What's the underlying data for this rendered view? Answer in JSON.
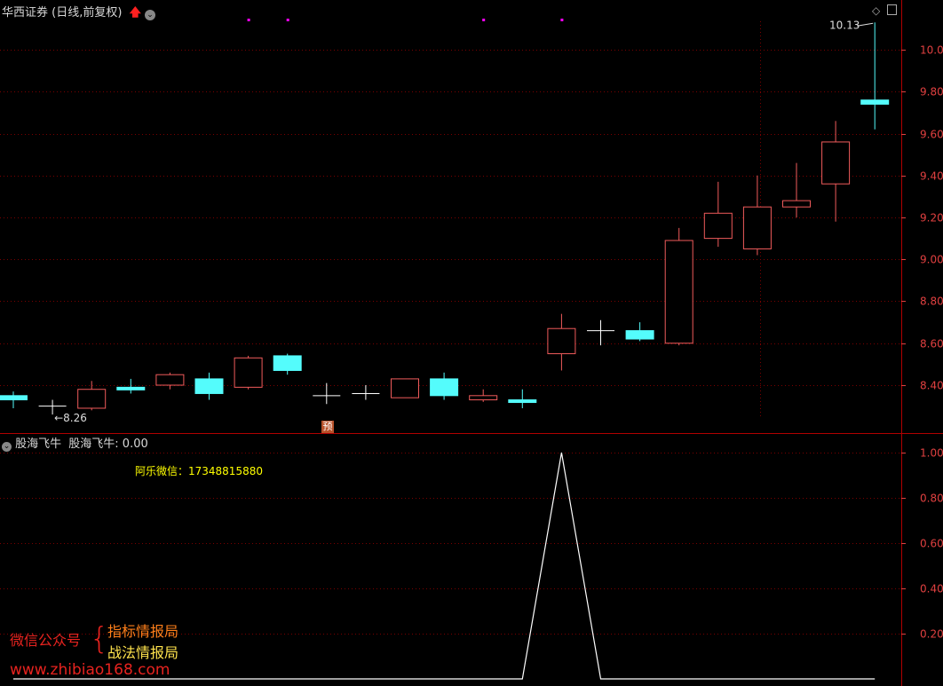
{
  "header": {
    "title": "华西证券 (日线,前复权)",
    "sub_indicator_name": "股海飞牛",
    "sub_indicator_label": "股海飞牛: 0.00",
    "contact": "阿乐微信：17348815880",
    "pre_badge": "预"
  },
  "watermark": {
    "left_text": "微信公众号",
    "line1": "指标情报局",
    "line2": "战法情报局",
    "url": "www.zhibiao168.com"
  },
  "colors": {
    "up": "#f05b5b",
    "down": "#54fcfc",
    "doji": "#ffffff",
    "grid": "#7a0000",
    "axis_text": "#e04040",
    "signal_line": "#ffffff",
    "marker": "#ff00ff",
    "contact_text": "#ffff00",
    "wm_red": "#e8231f",
    "wm_orange": "#ff7f1a",
    "wm_yellow": "#ffe34d"
  },
  "chart_data": [
    {
      "type": "candlestick",
      "title": "华西证券 (日线,前复权)",
      "ylim": [
        8.2,
        10.2
      ],
      "y_ticks": [
        "8.40",
        "8.60",
        "8.80",
        "9.00",
        "9.20",
        "9.40",
        "9.60",
        "9.80",
        "10.00"
      ],
      "high_label": "10.13",
      "low_label": "8.26",
      "candles": [
        {
          "o": 8.35,
          "h": 8.37,
          "l": 8.29,
          "c": 8.33
        },
        {
          "o": 8.3,
          "h": 8.33,
          "l": 8.26,
          "c": 8.3
        },
        {
          "o": 8.29,
          "h": 8.42,
          "l": 8.28,
          "c": 8.38
        },
        {
          "o": 8.39,
          "h": 8.43,
          "l": 8.36,
          "c": 8.38
        },
        {
          "o": 8.4,
          "h": 8.46,
          "l": 8.38,
          "c": 8.45
        },
        {
          "o": 8.43,
          "h": 8.46,
          "l": 8.33,
          "c": 8.36
        },
        {
          "o": 8.39,
          "h": 8.54,
          "l": 8.38,
          "c": 8.53
        },
        {
          "o": 8.54,
          "h": 8.55,
          "l": 8.45,
          "c": 8.47
        },
        {
          "o": 8.35,
          "h": 8.41,
          "l": 8.31,
          "c": 8.35
        },
        {
          "o": 8.36,
          "h": 8.4,
          "l": 8.33,
          "c": 8.36
        },
        {
          "o": 8.34,
          "h": 8.43,
          "l": 8.34,
          "c": 8.43
        },
        {
          "o": 8.43,
          "h": 8.46,
          "l": 8.33,
          "c": 8.35
        },
        {
          "o": 8.33,
          "h": 8.38,
          "l": 8.32,
          "c": 8.35
        },
        {
          "o": 8.33,
          "h": 8.38,
          "l": 8.29,
          "c": 8.32
        },
        {
          "o": 8.55,
          "h": 8.74,
          "l": 8.47,
          "c": 8.67
        },
        {
          "o": 8.66,
          "h": 8.71,
          "l": 8.59,
          "c": 8.66
        },
        {
          "o": 8.66,
          "h": 8.7,
          "l": 8.61,
          "c": 8.62
        },
        {
          "o": 8.6,
          "h": 9.15,
          "l": 8.59,
          "c": 9.09
        },
        {
          "o": 9.1,
          "h": 9.37,
          "l": 9.06,
          "c": 9.22
        },
        {
          "o": 9.05,
          "h": 9.4,
          "l": 9.02,
          "c": 9.25
        },
        {
          "o": 9.25,
          "h": 9.46,
          "l": 9.2,
          "c": 9.28
        },
        {
          "o": 9.36,
          "h": 9.66,
          "l": 9.18,
          "c": 9.56
        },
        {
          "o": 9.76,
          "h": 10.13,
          "l": 9.62,
          "c": 9.74
        }
      ],
      "markers": [
        6,
        7,
        12,
        14
      ],
      "pre_marker_index": 8
    },
    {
      "type": "line",
      "name": "股海飞牛",
      "ylim": [
        0,
        1.0
      ],
      "y_ticks": [
        "0.20",
        "0.40",
        "0.60",
        "0.80",
        "1.00"
      ],
      "values": [
        0,
        0,
        0,
        0,
        0,
        0,
        0,
        0,
        0,
        0,
        0,
        0,
        0,
        0,
        1,
        0,
        0,
        0,
        0,
        0,
        0,
        0,
        0
      ]
    }
  ]
}
